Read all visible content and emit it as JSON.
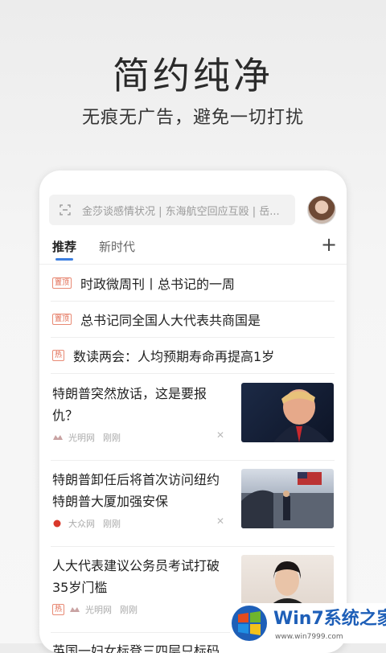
{
  "promo": {
    "headline": "简约纯净",
    "subline": "无痕无广告，避免一切打扰"
  },
  "search": {
    "placeholder": "金莎谈感情状况 | 东海航空回应互殴 | 岳..."
  },
  "tabs": {
    "recommend": "推荐",
    "new_era": "新时代",
    "plus": "+"
  },
  "pinned": [
    {
      "tag": "置顶",
      "title": "时政微周刊丨总书记的一周"
    },
    {
      "tag": "置顶",
      "title": "总书记同全国人大代表共商国是"
    },
    {
      "tag": "热",
      "title": "数读两会：人均预期寿命再提高1岁"
    }
  ],
  "news": [
    {
      "title": "特朗普突然放话，这是要报仇？",
      "source": "光明网",
      "time": "刚刚",
      "tag": ""
    },
    {
      "title": "特朗普卸任后将首次访问纽约特朗普大厦加强安保",
      "source": "大众网",
      "time": "刚刚",
      "tag": ""
    },
    {
      "title": "人大代表建议公务员考试打破35岁门槛",
      "source": "光明网",
      "time": "刚刚",
      "tag": "热"
    }
  ],
  "partial_item": "英国一妇女标登三四层只标码",
  "watermark": {
    "brand": "Win7系统之家",
    "url": "www.win7999.com"
  },
  "colors": {
    "accent": "#3b7ee0",
    "tag": "#e0664c"
  }
}
